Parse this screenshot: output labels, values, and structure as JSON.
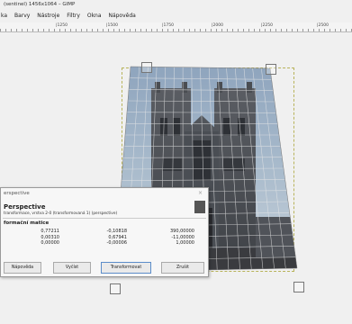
{
  "window": {
    "title": "(sentinel) 1456x1064 – GIMP"
  },
  "menubar": {
    "items": [
      "ka",
      "Barvy",
      "Nástroje",
      "Filtry",
      "Okna",
      "Nápověda"
    ]
  },
  "ruler": {
    "labels": [
      "|1250",
      "|1500",
      "|1750",
      "|2000",
      "|2250",
      "|2500"
    ]
  },
  "dialog": {
    "title": "erspective",
    "close": "×",
    "tool_name": "Perspective",
    "tool_sub": "transformace, vrstva 2-0 (transformovaná 1) (perspective)",
    "matrix_label": "formační matice",
    "matrix": [
      [
        "0,77211",
        "-0,10818",
        "390,00000"
      ],
      [
        "0,00310",
        "0,67941",
        "-11,00000"
      ],
      [
        "0,00000",
        "-0,00006",
        "1,00000"
      ]
    ],
    "buttons": {
      "reset": "Nápověda",
      "undo": "Vyčíst",
      "transform": "Transformovat",
      "cancel": "Zrušit"
    }
  }
}
